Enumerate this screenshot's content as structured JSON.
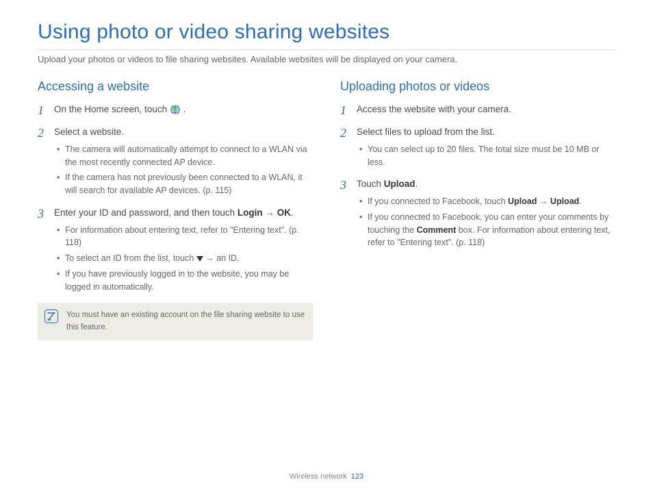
{
  "title": "Using photo or video sharing websites",
  "intro": "Upload your photos or videos to file sharing websites. Available websites will be displayed on your camera.",
  "left": {
    "heading": "Accessing a website",
    "steps": [
      {
        "n": "1",
        "text_a": "On the Home screen, touch ",
        "text_b": "."
      },
      {
        "n": "2",
        "text": "Select a website.",
        "subs": [
          "The camera will automatically attempt to connect to a WLAN via the most recently connected AP device.",
          "If the camera has not previously been connected to a WLAN, it will search for available AP devices. (p. 115)"
        ]
      },
      {
        "n": "3",
        "text_a": "Enter your ID and password, and then touch ",
        "bold1": "Login",
        "arrow": " → ",
        "bold2": "OK",
        "text_b": ".",
        "subs": [
          {
            "t": "For information about entering text, refer to \"Entering text\". (p. 118)"
          },
          {
            "t_a": "To select an ID from the list, touch ",
            "t_b": " → an ID.",
            "triangle": true
          },
          {
            "t": "If you have previously logged in to the website, you may be logged in automatically."
          }
        ]
      }
    ],
    "note": "You must have an existing account on the file sharing website to use this feature."
  },
  "right": {
    "heading": "Uploading photos or videos",
    "steps": [
      {
        "n": "1",
        "text": "Access the website with your camera."
      },
      {
        "n": "2",
        "text": "Select files to upload from the list.",
        "subs": [
          "You can select up to 20 files. The total size must be 10 MB or less."
        ]
      },
      {
        "n": "3",
        "text_a": "Touch ",
        "bold1": "Upload",
        "text_b": ".",
        "subs": [
          {
            "t_a": "If you connected to Facebook, touch ",
            "b1": "Upload",
            "arrow": " → ",
            "b2": "Upload",
            "t_b": "."
          },
          {
            "t_a": "If you connected to Facebook, you can enter your comments by touching the ",
            "b1": "Comment",
            "t_b": " box. For information about entering text, refer to \"Entering text\". (p. 118)"
          }
        ]
      }
    ]
  },
  "footer": {
    "section": "Wireless network",
    "page": "123"
  }
}
